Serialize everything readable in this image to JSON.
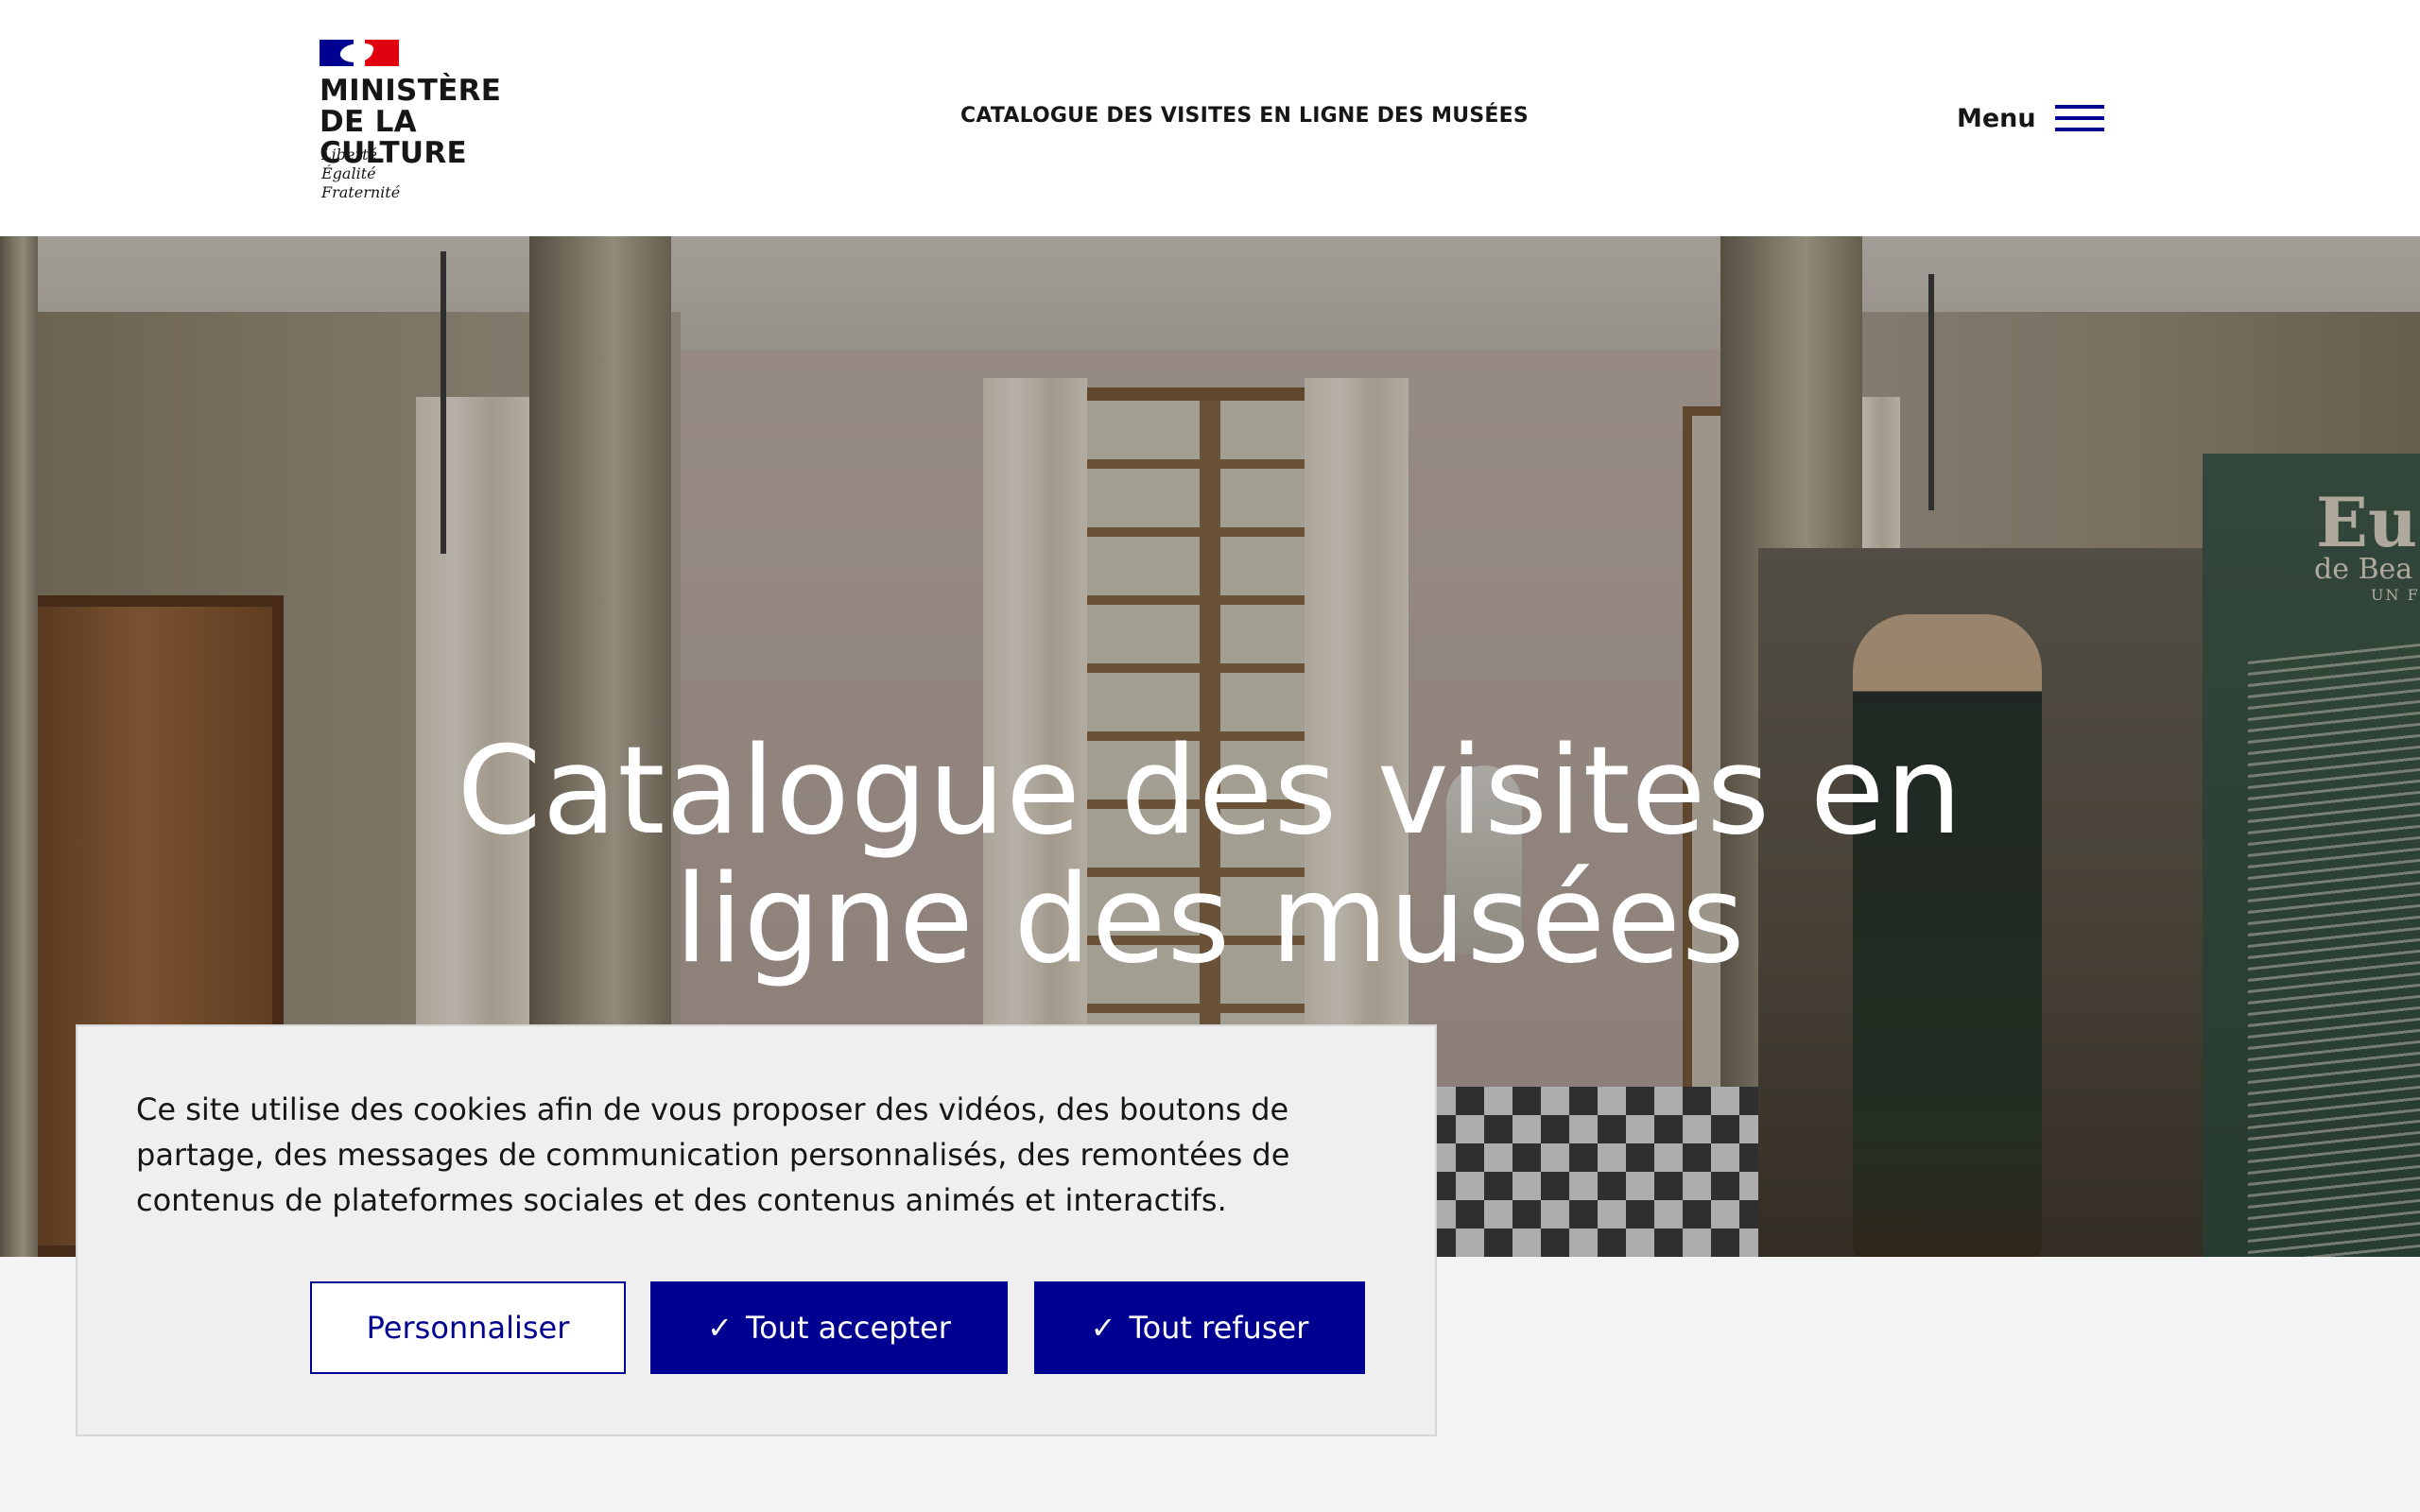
{
  "header": {
    "ministry_line1": "MINISTÈRE",
    "ministry_line2": "DE LA CULTURE",
    "motto": [
      "Liberté",
      "Égalité",
      "Fraternité"
    ],
    "site_title": "CATALOGUE DES VISITES EN LIGNE DES MUSÉES",
    "menu_label": "Menu"
  },
  "hero": {
    "title_line1": "Catalogue des visites en",
    "title_line2": "ligne des musées",
    "panel_title": "Eu",
    "panel_subtitle": "de Bea",
    "panel_subtitle2": "UN F"
  },
  "cookie_banner": {
    "text": "Ce site utilise des cookies afin de vous proposer des vidéos, des boutons de partage, des messages de communication personnalisés, des remontées de contenus de plateformes sociales et des contenus animés et interactifs.",
    "customize_label": "Personnaliser",
    "accept_label": "Tout accepter",
    "refuse_label": "Tout refuser",
    "check_glyph": "✓"
  },
  "colors": {
    "primary": "#000091",
    "marianne_red": "#e1000f",
    "text": "#161616",
    "background": "#f4f4f4"
  },
  "icons": {
    "logo": "marianne-flag-icon",
    "menu": "hamburger-icon",
    "check": "check-icon"
  }
}
